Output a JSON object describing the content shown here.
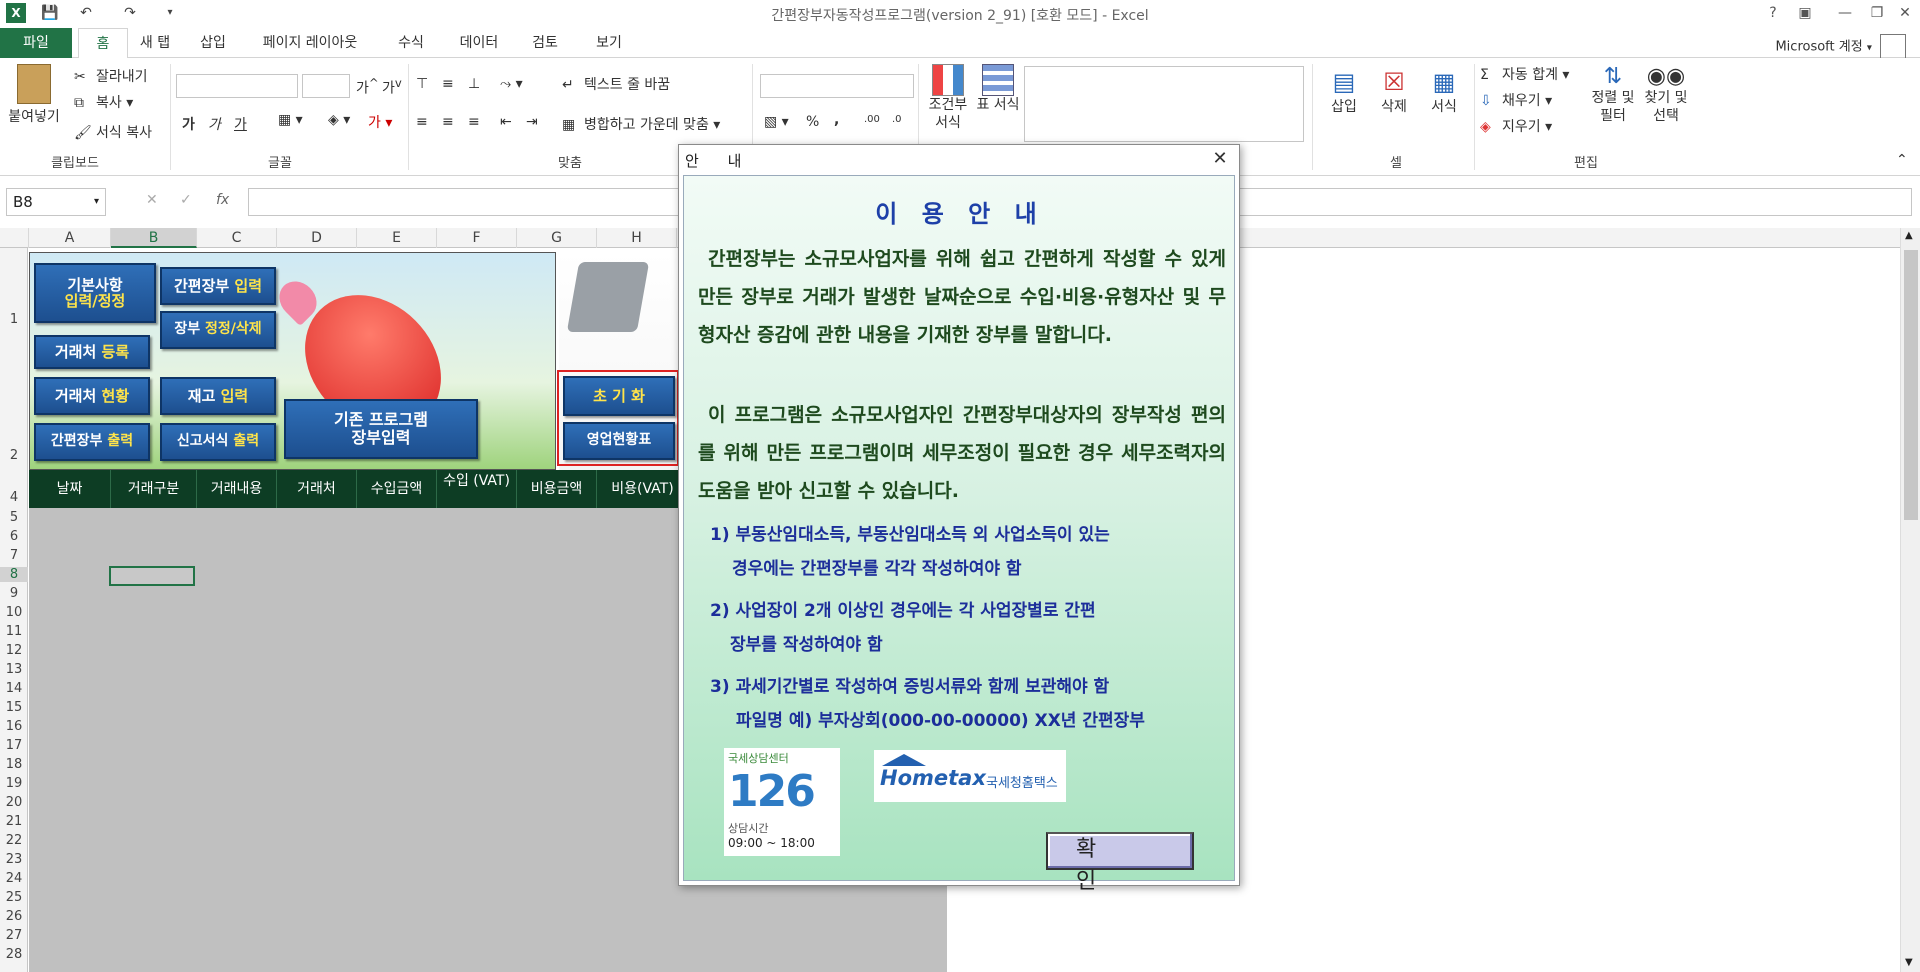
{
  "window": {
    "title": "간편장부자동작성프로그램(version 2_91)  [호환 모드] - Excel",
    "help": "?",
    "account": "Microsoft 계정"
  },
  "tabs": [
    "파일",
    "홈",
    "새 탭",
    "삽입",
    "페이지 레이아웃",
    "수식",
    "데이터",
    "검토",
    "보기"
  ],
  "ribbon": {
    "paste": "붙여넣기",
    "cut": "잘라내기",
    "copy": "복사",
    "format_painter": "서식 복사",
    "clipboard_label": "클립보드",
    "font_label": "글꼴",
    "align_label": "맞춤",
    "wrap_text": "텍스트 줄 바꿈",
    "merge_center": "병합하고 가운데 맞춤",
    "percent": "%",
    "comma": ",",
    "conditional_format": "조건부 서식",
    "table_format": "표 서식",
    "insert": "삽입",
    "delete": "삭제",
    "format": "서식",
    "cells_label": "셀",
    "autosum": "자동 합계",
    "fill": "채우기",
    "clear": "지우기",
    "sort_filter": "정렬 및 필터",
    "find_select": "찾기 및 선택",
    "edit_label": "편집",
    "font_bold": "가",
    "font_italic": "가",
    "font_underline": "가"
  },
  "formula_bar": {
    "name_box": "B8",
    "fx": "fx",
    "value": ""
  },
  "columns": [
    "A",
    "B",
    "C",
    "D",
    "E",
    "F",
    "G",
    "H"
  ],
  "rows": [
    "1",
    "2",
    "4",
    "5",
    "6",
    "7",
    "8",
    "9",
    "10",
    "11",
    "12",
    "13",
    "14",
    "15",
    "16",
    "17",
    "18",
    "19",
    "20",
    "21",
    "22",
    "23",
    "24",
    "25",
    "26",
    "27",
    "28"
  ],
  "banner_buttons": {
    "basic_info_1": "기본사항",
    "basic_info_2": "입력/정정",
    "ledger_input_a": "간편장부",
    "ledger_input_b": "입력",
    "ledger_edit_a": "장부",
    "ledger_edit_b": "정정/삭제",
    "client_reg_a": "거래처",
    "client_reg_b": "등록",
    "client_status_a": "거래처",
    "client_status_b": "현황",
    "stock_input_a": "재고",
    "stock_input_b": "입력",
    "ledger_print_a": "간편장부",
    "ledger_print_b": "출력",
    "tax_print_a": "신고서식",
    "tax_print_b": "출력",
    "legacy_1": "기존 프로그램",
    "legacy_2": "장부입력",
    "init": "초 기 화",
    "biz_status": "영업현황표"
  },
  "header_row": [
    "날짜",
    "거래구분",
    "거래내용",
    "거래처",
    "수입금액",
    "수입 (VAT)",
    "비용금액",
    "비용(VAT)"
  ],
  "dialog": {
    "title": "안 내",
    "heading": "이 용 안 내",
    "para1": "간편장부는 소규모사업자를 위해 쉽고 간편하게 작성할 수 있게 만든 장부로 거래가 발생한 날짜순으로 수입·비용·유형자산 및 무형자산 증감에 관한 내용을 기재한 장부를 말합니다.",
    "para2": "이 프로그램은 소규모사업자인 간편장부대상자의 장부작성 편의를 위해 만든 프로그램이며 세무조정이 필요한 경우 세무조력자의 도움을 받아 신고할 수 있습니다.",
    "note1_a": "1) 부동산임대소득, 부동산임대소득 외 사업소득이 있는",
    "note1_b": "경우에는 간편장부를 각각 작성하여야 함",
    "note2_a": "2) 사업장이 2개 이상인 경우에는 각 사업장별로 간편",
    "note2_b": "장부를 작성하여야 함",
    "note3_a": "3) 과세기간별로 작성하여 증빙서류와 함께 보관해야 함",
    "note3_b": "파일명 예) 부자상회(000-00-00000) XX년 간편장부",
    "logo126_top": "국세상담센터",
    "logo126_num": "126",
    "logo126_hours_label": "상담시간",
    "logo126_hours": "09:00 ~ 18:00",
    "hometax_brand": "Hometax",
    "hometax_sub": "국세청홈택스",
    "ok": "확 인"
  }
}
